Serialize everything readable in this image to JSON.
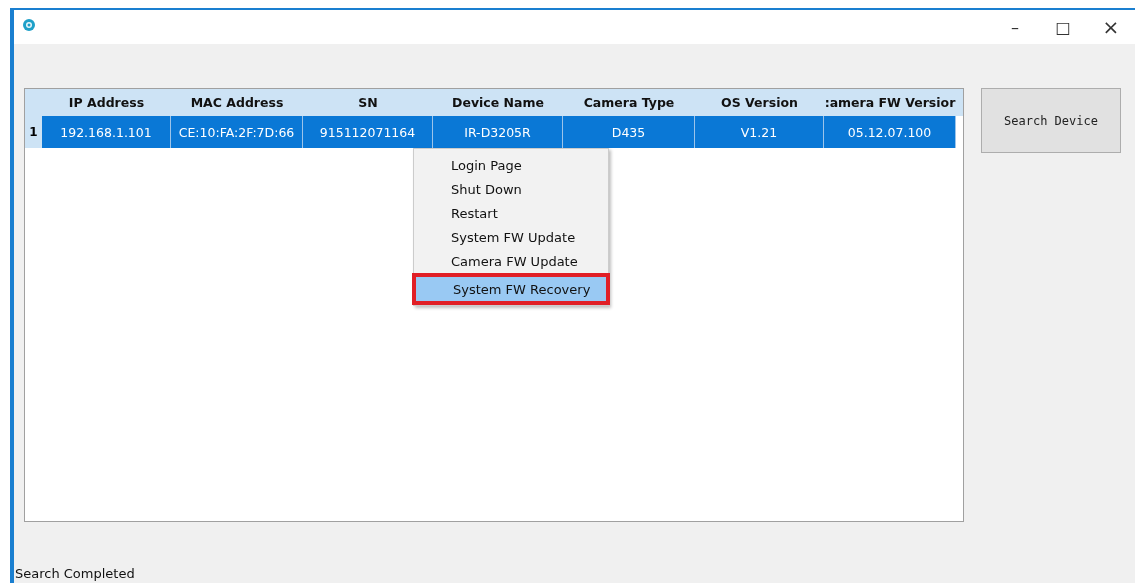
{
  "window": {
    "controls": [
      "–",
      "□",
      "×"
    ]
  },
  "table": {
    "columns": [
      "IP Address",
      "MAC Address",
      "SN",
      "Device Name",
      "Camera Type",
      "OS Version",
      ":amera FW Versior"
    ],
    "rows": [
      {
        "index": "1",
        "selected": true,
        "cells": [
          "192.168.1.101",
          "CE:10:FA:2F:7D:66",
          "915112071164",
          "IR-D3205R",
          "D435",
          "V1.21",
          "05.12.07.100"
        ]
      }
    ]
  },
  "context_menu": {
    "items": [
      {
        "label": "Login Page",
        "selected": false
      },
      {
        "label": "Shut Down",
        "selected": false
      },
      {
        "label": "Restart",
        "selected": false
      },
      {
        "label": "System FW Update",
        "selected": false
      },
      {
        "label": "Camera FW Update",
        "selected": false
      },
      {
        "label": "System FW Recovery",
        "selected": true
      }
    ]
  },
  "search_button": "Search Device",
  "status_bar": "Search Completed"
}
